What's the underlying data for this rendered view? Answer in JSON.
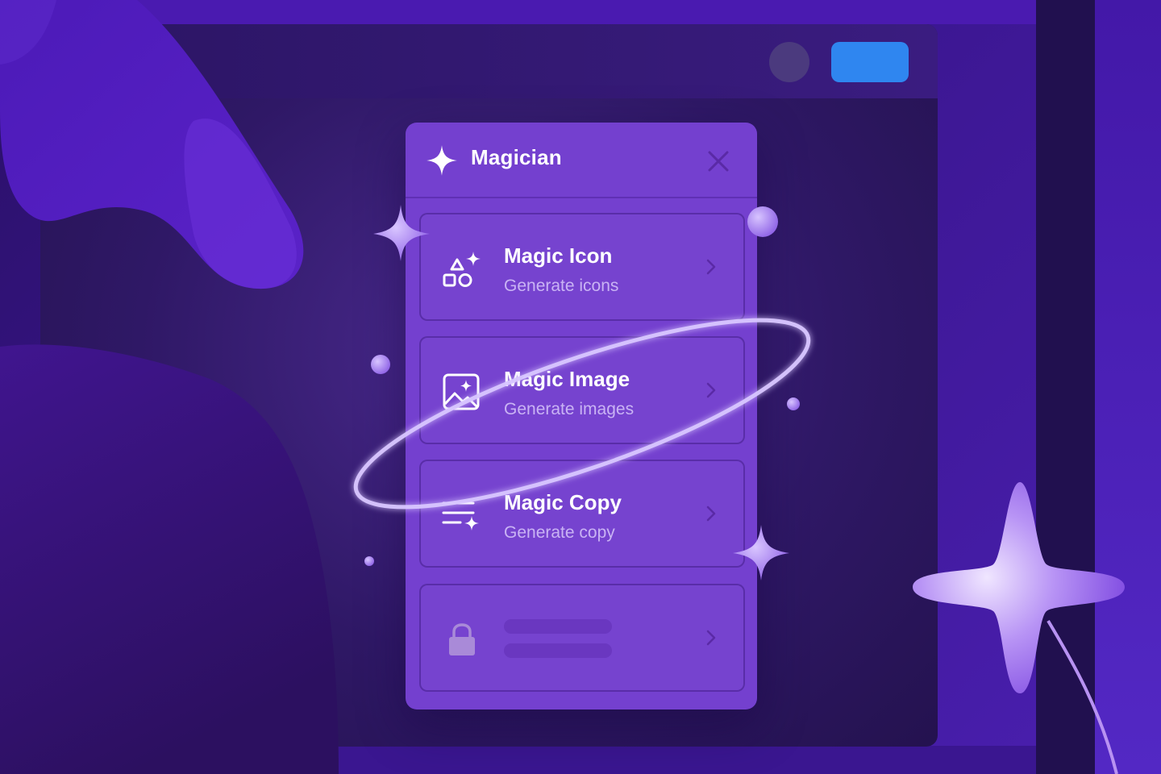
{
  "panel": {
    "title": "Magician",
    "items": [
      {
        "title": "Magic Icon",
        "subtitle": "Generate icons",
        "icon": "shapes-sparkle-icon"
      },
      {
        "title": "Magic Image",
        "subtitle": "Generate images",
        "icon": "image-sparkle-icon"
      },
      {
        "title": "Magic Copy",
        "subtitle": "Generate copy",
        "icon": "text-sparkle-icon"
      },
      {
        "title": "",
        "subtitle": "",
        "icon": "lock-icon",
        "locked": true
      }
    ]
  },
  "colors": {
    "panel": "#7440cf",
    "accent_button": "#2f86f0",
    "background": "#3a1a8c",
    "text_primary": "#ffffff",
    "text_secondary": "#c9b3f4"
  }
}
